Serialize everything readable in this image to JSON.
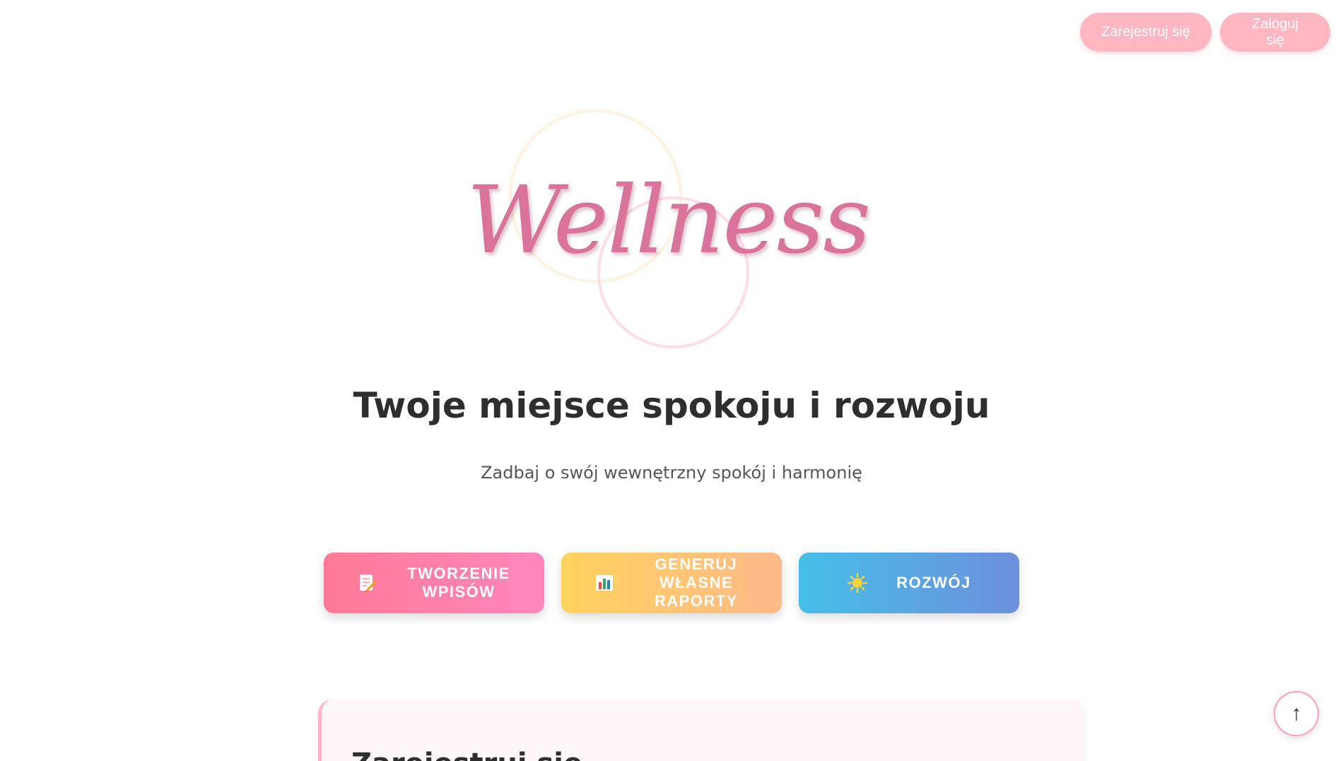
{
  "header": {
    "register_label": "Zarejestruj się",
    "login_label": "Zaloguj się"
  },
  "logo": {
    "text": "Wellness"
  },
  "hero": {
    "title": "Twoje miejsce spokoju i rozwoju",
    "subtitle": "Zadbaj o swój wewnętrzny spokój i harmonię"
  },
  "features": [
    {
      "label": "TWORZENIE WPISÓW",
      "icon": "memo-icon",
      "color": "#ff7a96"
    },
    {
      "label": "GENERUJ WŁASNE RAPORTY",
      "icon": "bar-chart-icon",
      "color": "#ffd25e"
    },
    {
      "label": "ROZWÓJ",
      "icon": "sun-icon",
      "color": "#45bfe8"
    }
  ],
  "card": {
    "title": "Zarejestruj się"
  },
  "scroll_top": {
    "glyph": "↑"
  },
  "colors": {
    "auth_button": "#ffb6c1",
    "logo": "#d9739c",
    "card_background": "#fff6f8"
  }
}
